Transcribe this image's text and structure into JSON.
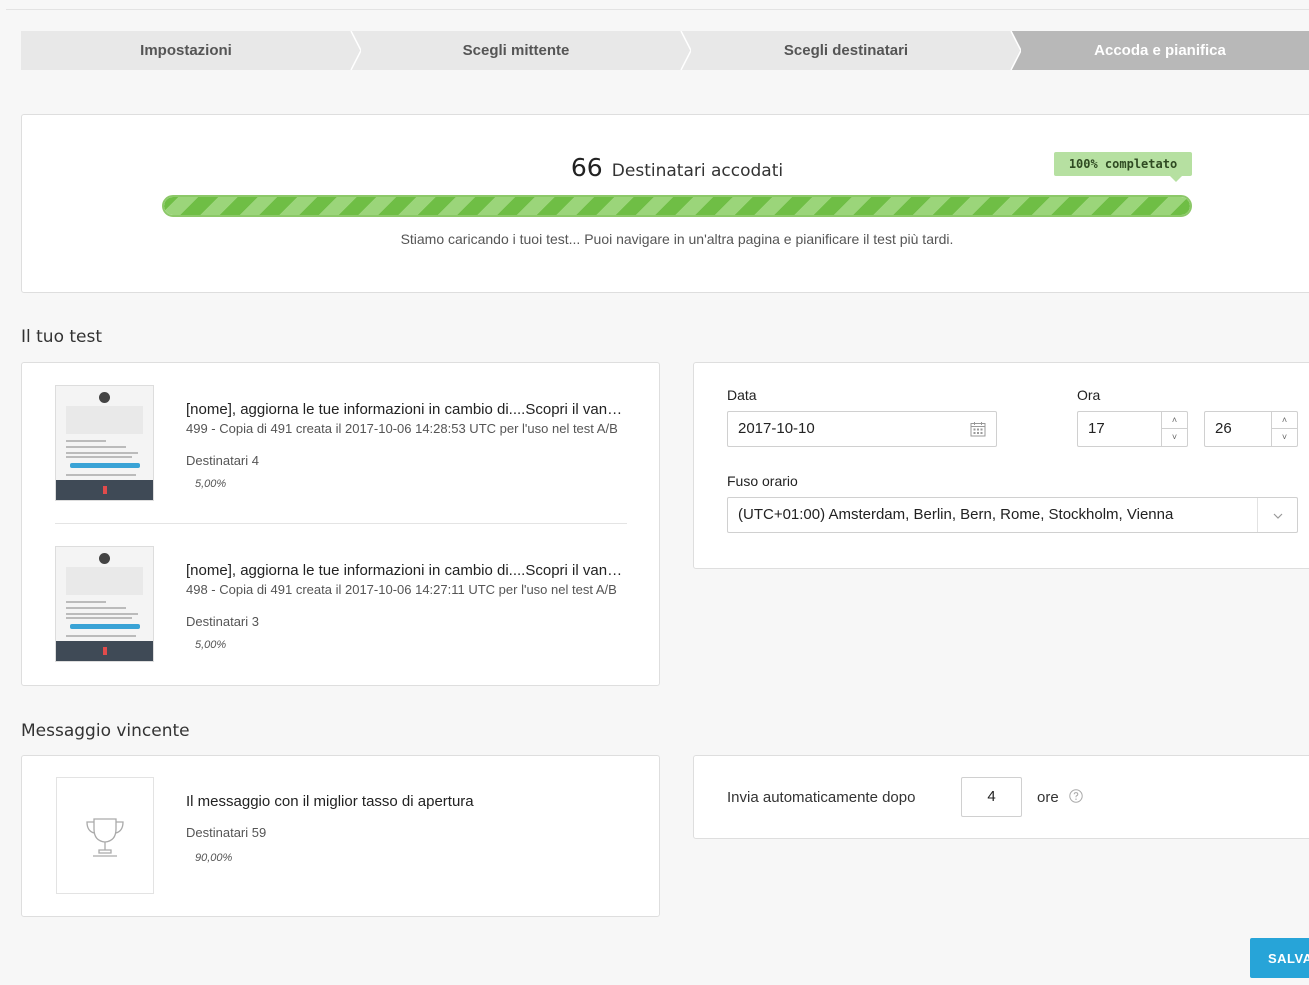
{
  "wizard": {
    "steps": [
      {
        "label": "Impostazioni"
      },
      {
        "label": "Scegli mittente"
      },
      {
        "label": "Scegli destinatari"
      },
      {
        "label": "Accoda e pianifica"
      }
    ],
    "active_step": 4
  },
  "progress": {
    "count": "66",
    "count_label": "Destinatari accodati",
    "badge": "100% completato",
    "percent": 100,
    "note": "Stiamo caricando i tuoi test... Puoi navigare in un'altra pagina e pianificare il test più tardi."
  },
  "tests_section": {
    "title": "Il tuo test",
    "items": [
      {
        "title": "[nome], aggiorna le tue informazioni in cambio di....Scopri il vantaggio",
        "subtitle": "499 - Copia di 491 creata il 2017-10-06 14:28:53 UTC per l'uso nel test A/B",
        "recipients": "Destinatari 4",
        "percent": "5,00%"
      },
      {
        "title": "[nome], aggiorna le tue informazioni in cambio di....Scopri il vantaggio",
        "subtitle": "498 - Copia di 491 creata il 2017-10-06 14:27:11 UTC per l'uso nel test A/B",
        "recipients": "Destinatari 3",
        "percent": "5,00%"
      }
    ]
  },
  "schedule": {
    "date_label": "Data",
    "date_value": "2017-10-10",
    "time_label": "Ora",
    "hour_value": "17",
    "minute_value": "26",
    "timezone_label": "Fuso orario",
    "timezone_value": "(UTC+01:00) Amsterdam, Berlin, Bern, Rome, Stockholm, Vienna"
  },
  "winner_section": {
    "title": "Messaggio vincente",
    "message_title": "Il messaggio con il miglior tasso di apertura",
    "recipients": "Destinatari 59",
    "percent": "90,00%"
  },
  "auto_send": {
    "label": "Invia automaticamente dopo",
    "value": "4",
    "unit": "ore"
  },
  "actions": {
    "save_label": "SALVA"
  },
  "colors": {
    "progress_green": "#6fbe45",
    "badge_green": "#b6e0a1",
    "save_blue": "#27a4d8",
    "active_step_gray": "#b8b8b8"
  }
}
